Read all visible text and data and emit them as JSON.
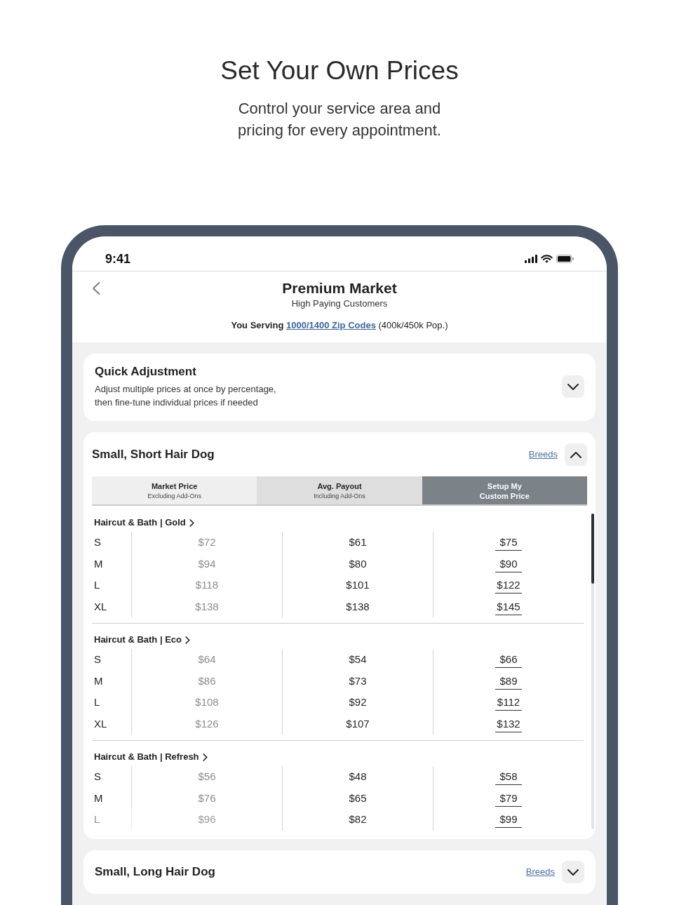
{
  "intro": {
    "title": "Set Your Own Prices",
    "subtitle": "Control your service area and pricing for every appointment."
  },
  "status_bar": {
    "time": "9:41"
  },
  "header": {
    "title": "Premium Market",
    "subtitle": "High Paying Customers",
    "serving": {
      "label": "You Serving",
      "link": "1000/1400 Zip Codes",
      "note": "(400k/450k Pop.)"
    }
  },
  "quick_adjustment": {
    "title": "Quick Adjustment",
    "description": "Adjust multiple prices at once by percentage, then fine-tune individual prices if needed",
    "expanded": false
  },
  "categories": [
    {
      "title": "Small, Short Hair Dog",
      "breeds_link": "Breeds",
      "expanded": true,
      "columns": [
        {
          "kind": "market",
          "label": "Market Price",
          "note": "Excluding Add-Ons"
        },
        {
          "kind": "payout",
          "label": "Avg. Payout",
          "note": "Including Add-Ons"
        },
        {
          "kind": "custom",
          "label": "Setup My Custom Price"
        }
      ],
      "sections": [
        {
          "title": "Haircut & Bath | Gold",
          "rows": [
            {
              "size": "S",
              "prices": [
                "$72",
                "$61",
                "$75"
              ]
            },
            {
              "size": "M",
              "prices": [
                "$94",
                "$80",
                "$90"
              ]
            },
            {
              "size": "L",
              "prices": [
                "$118",
                "$101",
                "$122"
              ]
            },
            {
              "size": "XL",
              "prices": [
                "$138",
                "$138",
                "$145"
              ]
            }
          ]
        },
        {
          "title": "Haircut & Bath | Eco",
          "rows": [
            {
              "size": "S",
              "prices": [
                "$64",
                "$54",
                "$66"
              ]
            },
            {
              "size": "M",
              "prices": [
                "$86",
                "$73",
                "$89"
              ]
            },
            {
              "size": "L",
              "prices": [
                "$108",
                "$92",
                "$112"
              ]
            },
            {
              "size": "XL",
              "prices": [
                "$126",
                "$107",
                "$132"
              ]
            }
          ]
        },
        {
          "title": "Haircut & Bath | Refresh",
          "rows": [
            {
              "size": "S",
              "prices": [
                "$56",
                "$48",
                "$58"
              ]
            },
            {
              "size": "M",
              "prices": [
                "$76",
                "$65",
                "$79"
              ]
            },
            {
              "size": "L",
              "prices": [
                "$96",
                "$82",
                "$99"
              ]
            }
          ]
        }
      ]
    },
    {
      "title": "Small, Long Hair Dog",
      "breeds_link": "Breeds",
      "expanded": false
    }
  ]
}
